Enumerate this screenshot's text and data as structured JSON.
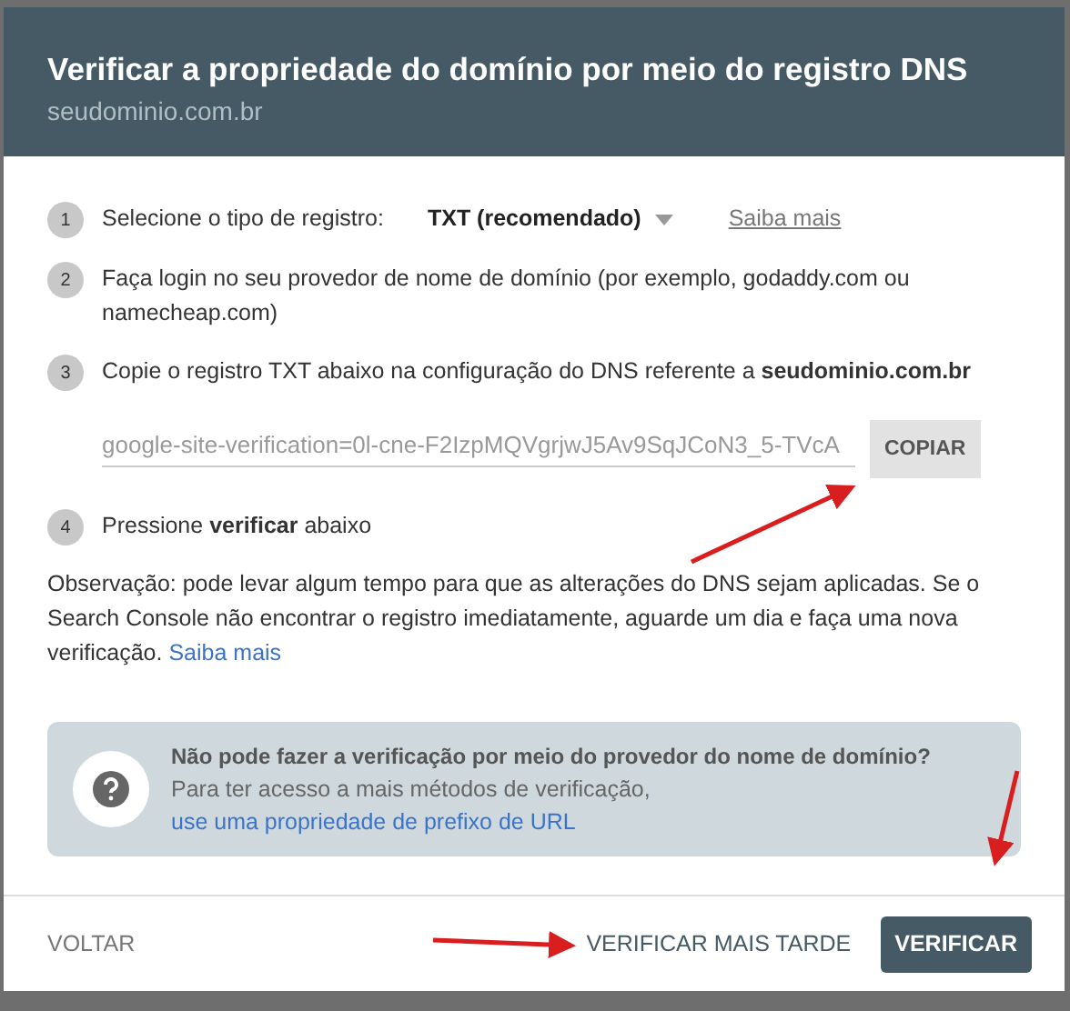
{
  "dialog": {
    "title": "Verificar a propriedade do domínio por meio do registro DNS",
    "subtitle": "seudominio.com.br"
  },
  "steps": [
    {
      "kind": "select",
      "number": "1",
      "label": "Selecione o tipo de registro:",
      "select_value": "TXT (recomendado)",
      "link": "Saiba mais"
    },
    {
      "kind": "text",
      "number": "2",
      "text": "Faça login no seu provedor de nome de domínio (por exemplo, godaddy.com ou namecheap.com)"
    },
    {
      "kind": "text",
      "number": "3",
      "text": "Copie o registro TXT abaixo na configuração do DNS referente a **seudominio.com.br**"
    },
    {
      "kind": "copy",
      "value": "google-site-verification=0l-cne-F2IzpMQVgrjwJ5Av9SqJCoN3_5-TVcA",
      "button": "COPIAR"
    },
    {
      "kind": "text",
      "number": "4",
      "text": "Pressione **verificar** abaixo"
    }
  ],
  "note": {
    "text": "Observação: pode levar algum tempo para que as alterações do DNS sejam aplicadas. Se o Search Console não encontrar o registro imediatamente, aguarde um dia e faça uma nova verificação.",
    "link": "Saiba mais"
  },
  "help_box": {
    "title": "Não pode fazer a verificação por meio do provedor do nome de domínio?",
    "text": "Para ter acesso a mais métodos de verificação,",
    "link": "use uma propriedade de prefixo de URL"
  },
  "footer": {
    "back": "VOLTAR",
    "later": "VERIFICAR MAIS TARDE",
    "verify": "VERIFICAR"
  }
}
